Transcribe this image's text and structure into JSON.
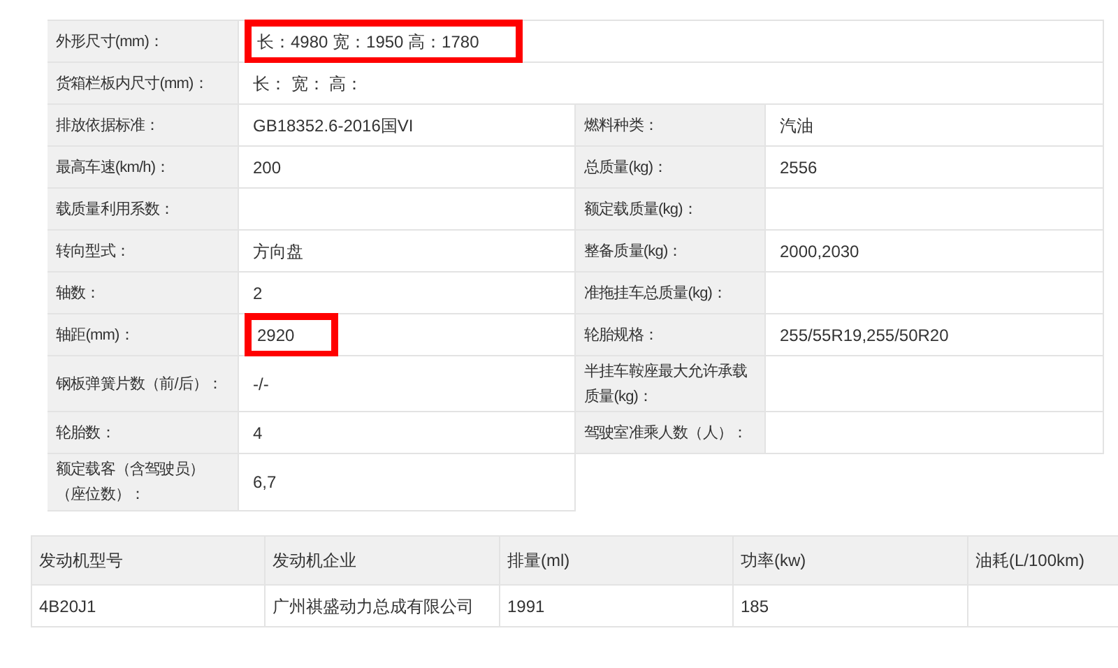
{
  "spec_table": {
    "rows": [
      {
        "kind": "wide",
        "cells": [
          {
            "label": "外形尺寸(mm)：",
            "value": "长：4980 宽：1950 高：1780",
            "highlighted": true
          }
        ]
      },
      {
        "kind": "wide",
        "cells": [
          {
            "label": "货箱栏板内尺寸(mm)：",
            "value": "长： 宽： 高：",
            "highlighted": false
          }
        ]
      },
      {
        "kind": "pair",
        "cells": [
          {
            "label": "排放依据标准：",
            "value": "GB18352.6-2016国VI",
            "highlighted": false
          },
          {
            "label": "燃料种类：",
            "value": "汽油",
            "highlighted": false
          }
        ]
      },
      {
        "kind": "pair",
        "cells": [
          {
            "label": "最高车速(km/h)：",
            "value": "200",
            "highlighted": false
          },
          {
            "label": "总质量(kg)：",
            "value": "2556",
            "highlighted": false
          }
        ]
      },
      {
        "kind": "pair",
        "cells": [
          {
            "label": "载质量利用系数：",
            "highlighted": false
          },
          {
            "label": "额定载质量(kg)：",
            "highlighted": false
          }
        ]
      },
      {
        "kind": "pair",
        "cells": [
          {
            "label": "转向型式：",
            "value": "方向盘",
            "highlighted": false
          },
          {
            "label": "整备质量(kg)：",
            "value": "2000,2030",
            "highlighted": false
          }
        ]
      },
      {
        "kind": "pair",
        "cells": [
          {
            "label": "轴数：",
            "value": "2",
            "highlighted": false
          },
          {
            "label": "准拖挂车总质量(kg)：",
            "highlighted": false
          }
        ]
      },
      {
        "kind": "pair",
        "cells": [
          {
            "label": "轴距(mm)：",
            "value": "2920",
            "highlighted": true
          },
          {
            "label": "轮胎规格：",
            "value": "255/55R19,255/50R20",
            "highlighted": false
          }
        ]
      },
      {
        "kind": "pair",
        "cells": [
          {
            "label": "钢板弹簧片数（前/后）：",
            "value": "-/-",
            "highlighted": false
          },
          {
            "label": "半挂车鞍座最大允许承载质量(kg)：",
            "highlighted": false
          }
        ]
      },
      {
        "kind": "pair",
        "cells": [
          {
            "label": "轮胎数：",
            "value": "4",
            "highlighted": false
          },
          {
            "label": "驾驶室准乘人数（人）：",
            "highlighted": false
          }
        ]
      },
      {
        "kind": "half",
        "cells": [
          {
            "label": "额定载客（含驾驶员）（座位数）：",
            "value": "6,7",
            "highlighted": false
          }
        ]
      }
    ]
  },
  "engine_table": {
    "columns": [
      "发动机型号",
      "发动机企业",
      "排量(ml)",
      "功率(kw)",
      "油耗(L/100km)"
    ],
    "rows": [
      [
        "4B20J1",
        "广州祺盛动力总成有限公司",
        "1991",
        "185",
        null
      ]
    ]
  }
}
